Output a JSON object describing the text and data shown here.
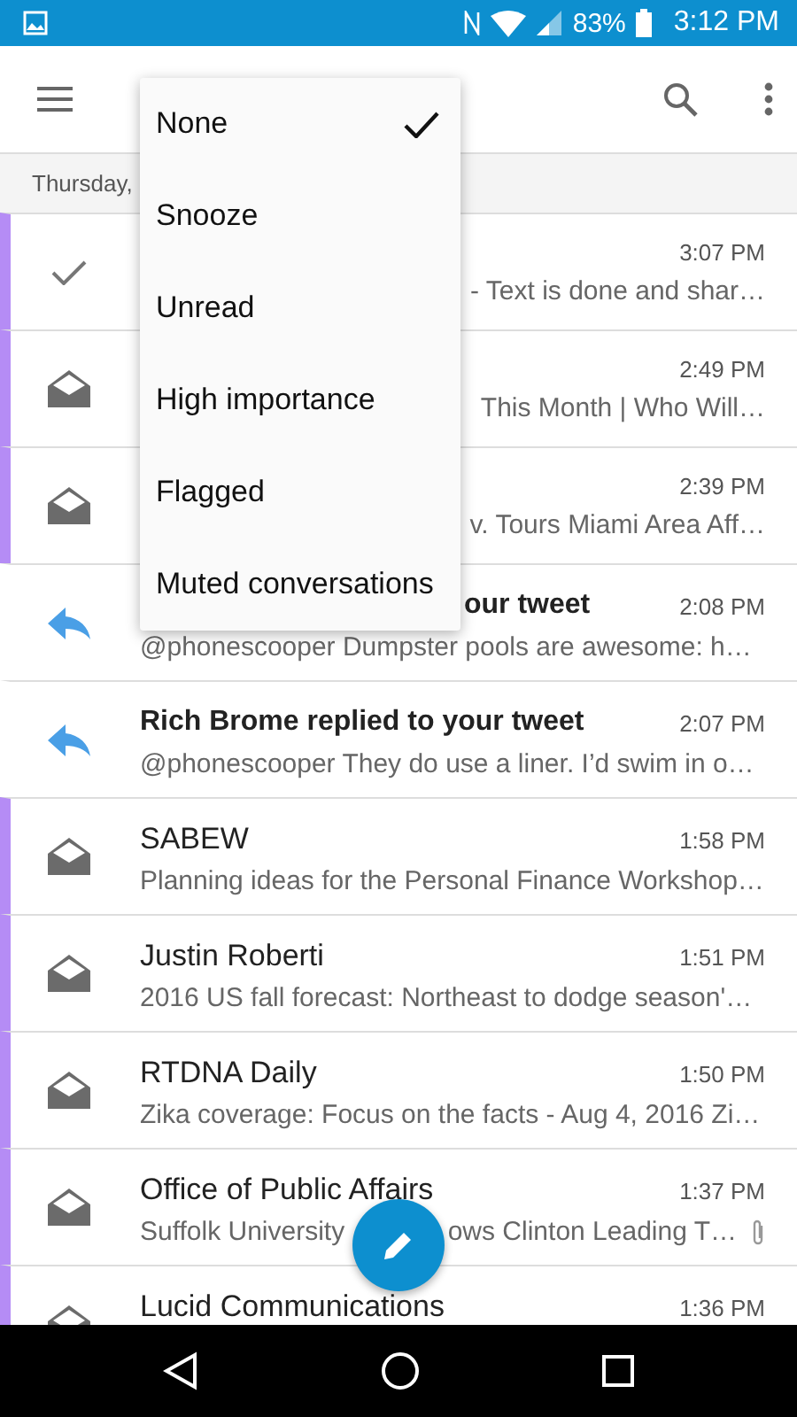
{
  "status_bar": {
    "battery": "83%",
    "time": "3:12 PM"
  },
  "day_header": "Thursday,",
  "rows": [
    {
      "kind": "done",
      "marked": true,
      "preview": "- Text is done and shar…",
      "time": "3:07 PM",
      "preview_cut": true
    },
    {
      "kind": "mail",
      "marked": true,
      "preview": "This Month | Who Will…",
      "time": "2:49 PM",
      "preview_cut": true
    },
    {
      "kind": "mail",
      "marked": true,
      "preview": "v. Tours Miami Area Aff…",
      "time": "2:39 PM",
      "preview_cut": true
    },
    {
      "kind": "reply",
      "marked": false,
      "sender": "our tweet",
      "sender_bold": true,
      "sender_cut": true,
      "time": "2:08 PM",
      "preview": "@phonescooper Dumpster pools are awesome:  h…"
    },
    {
      "kind": "reply",
      "marked": false,
      "sender": "Rich Brome replied to your tweet",
      "sender_bold": true,
      "time": "2:07 PM",
      "preview": "@phonescooper They do use a liner. I’d swim in o…"
    },
    {
      "kind": "mail",
      "marked": true,
      "sender": "SABEW",
      "time": "1:58 PM",
      "preview": "Planning ideas for the Personal Finance Workshop…"
    },
    {
      "kind": "mail",
      "marked": true,
      "sender": "Justin Roberti",
      "time": "1:51 PM",
      "preview": "2016 US fall forecast: Northeast to dodge season'…"
    },
    {
      "kind": "mail",
      "marked": true,
      "sender": "RTDNA Daily",
      "time": "1:50 PM",
      "preview": "Zika coverage: Focus on the facts - Aug 4, 2016 Zi…"
    },
    {
      "kind": "mail",
      "marked": true,
      "sender": "Office of Public Affairs",
      "time": "1:37 PM",
      "preview": "Suffolk University",
      "preview_2": "ows Clinton Leading T…",
      "attachment": true
    },
    {
      "kind": "mail",
      "marked": true,
      "sender": "Lucid Communications",
      "time": "1:36 PM"
    }
  ],
  "filter_menu": [
    {
      "label": "None",
      "selected": true
    },
    {
      "label": "Snooze",
      "selected": false
    },
    {
      "label": "Unread",
      "selected": false
    },
    {
      "label": "High importance",
      "selected": false
    },
    {
      "label": "Flagged",
      "selected": false
    },
    {
      "label": "Muted conversations",
      "selected": false
    }
  ]
}
